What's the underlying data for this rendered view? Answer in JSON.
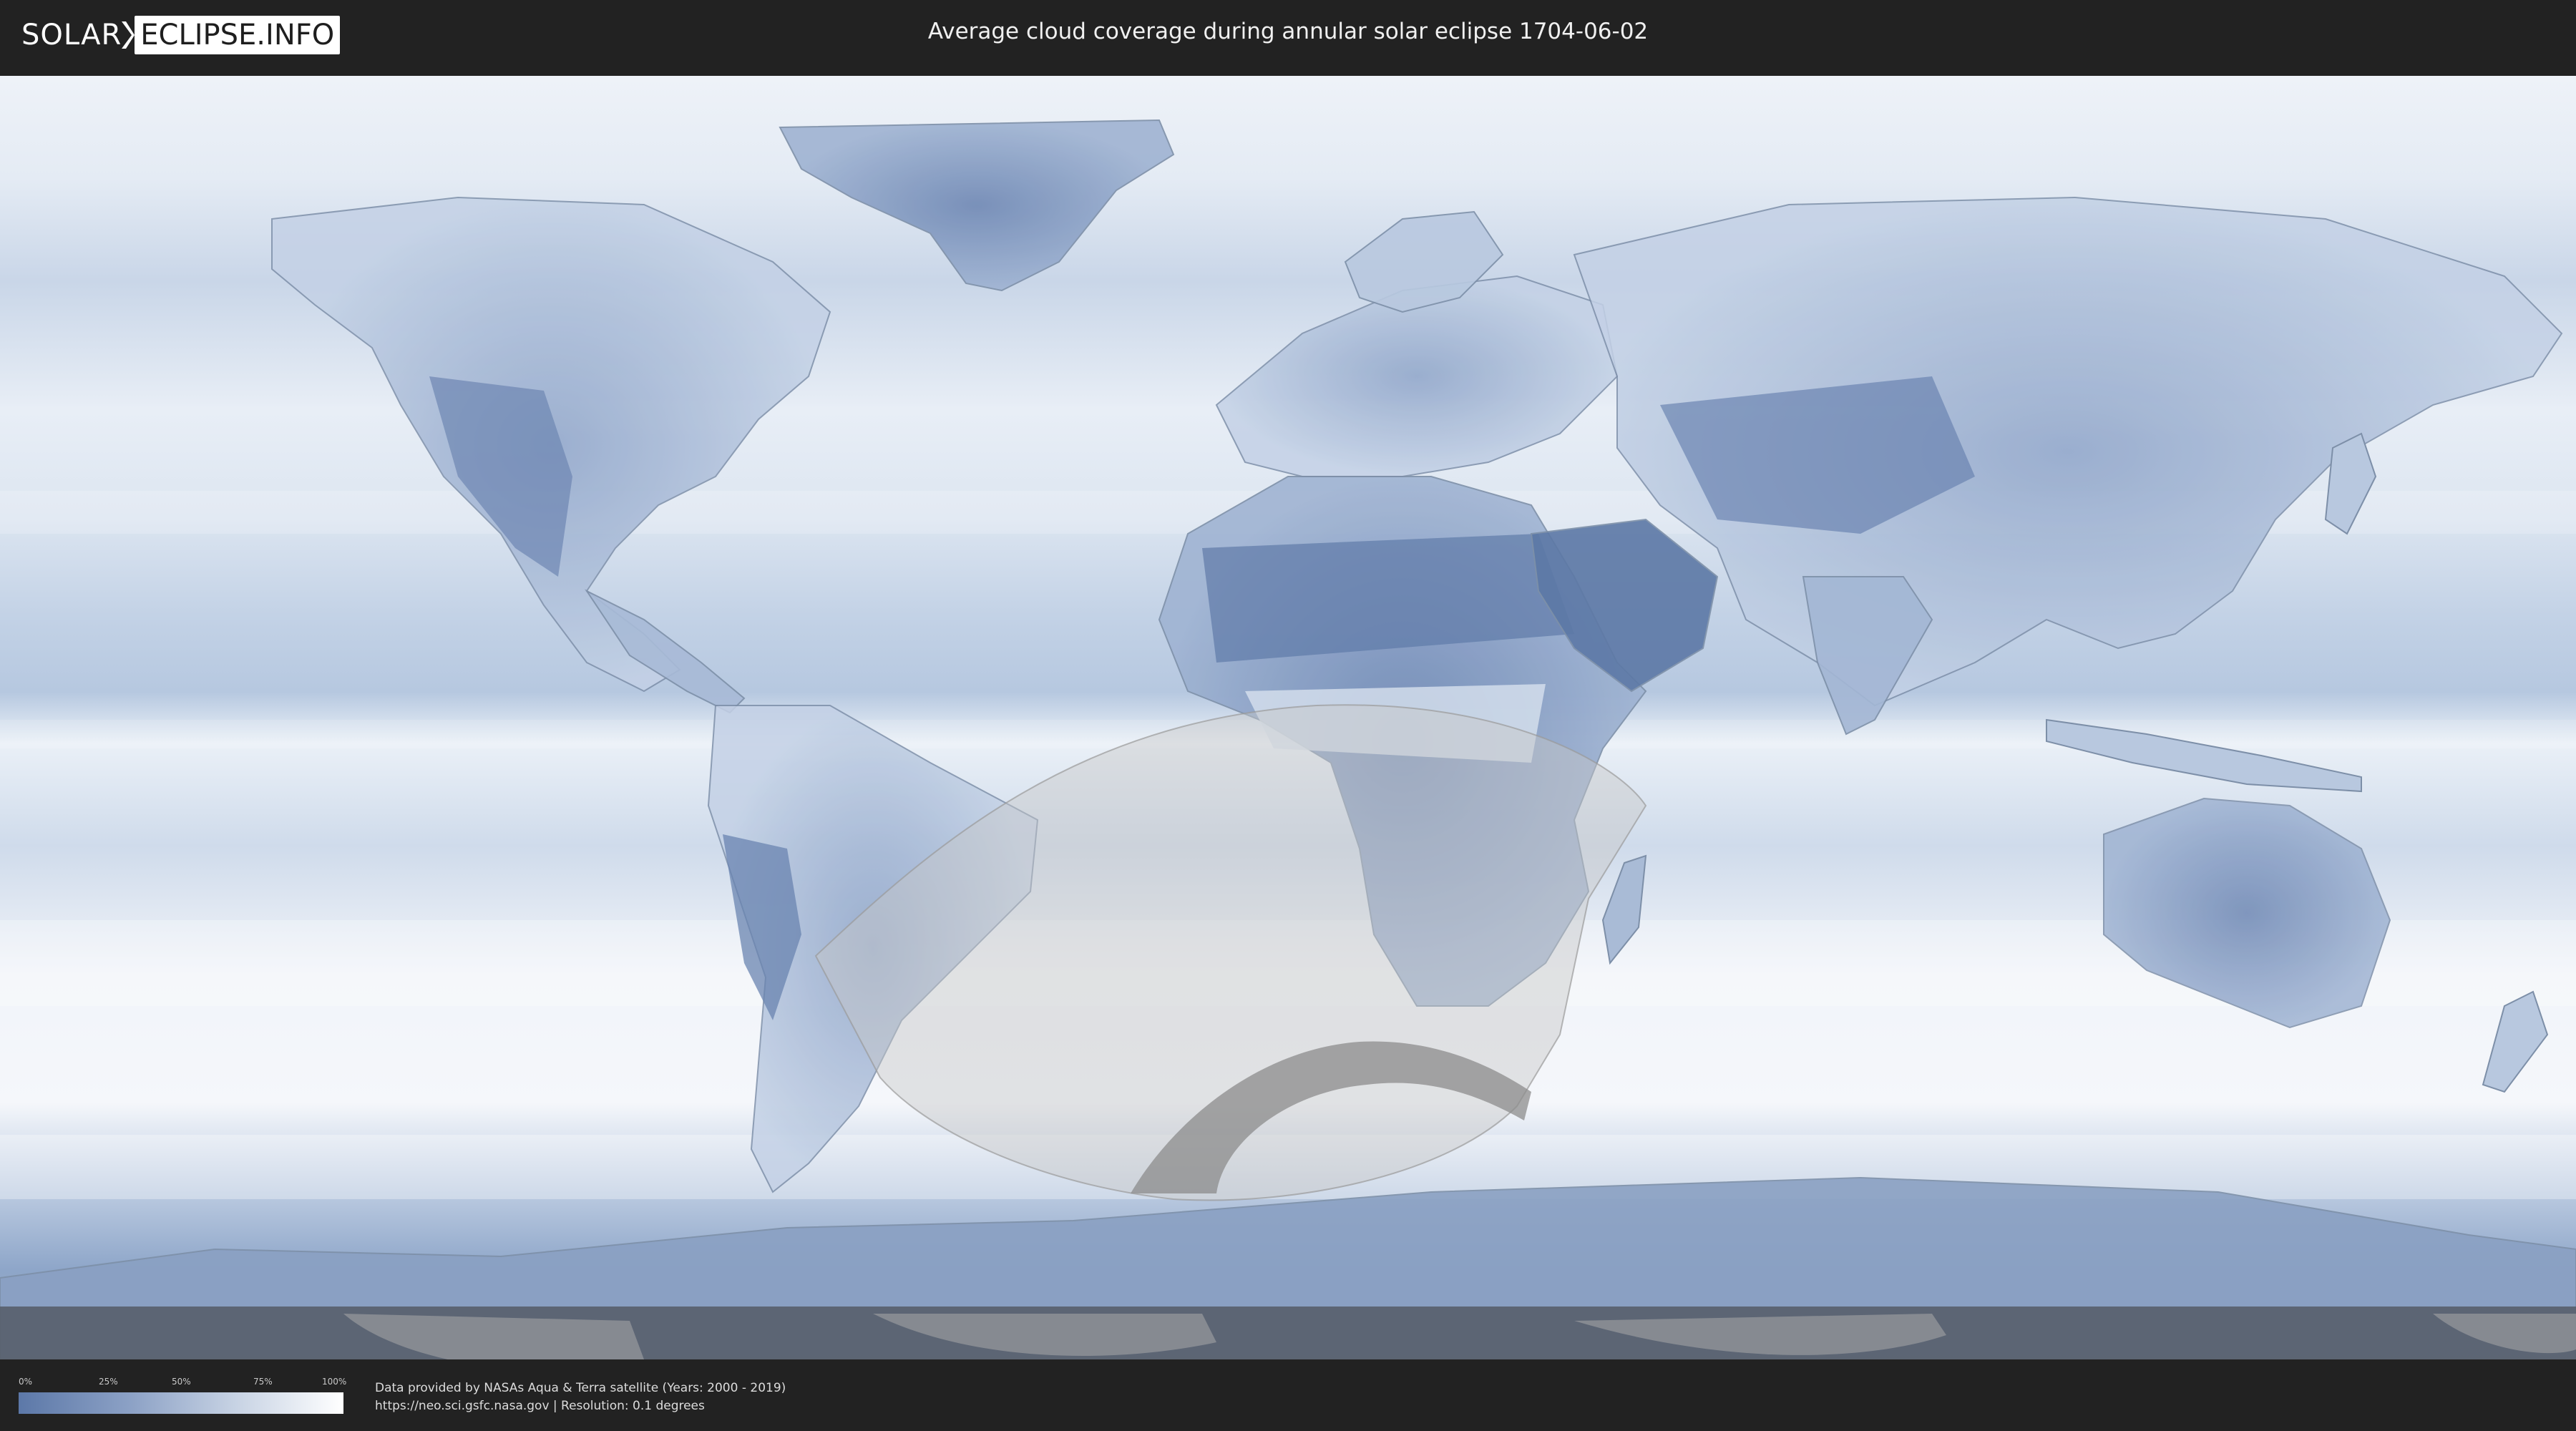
{
  "header": {
    "logo_left": "SOLAR",
    "logo_right": "ECLIPSE.INFO",
    "title": "Average cloud coverage during annular solar eclipse 1704-06-02"
  },
  "map": {
    "type": "equirectangular world map",
    "layer": "average cloud coverage",
    "eclipse_type": "annular",
    "eclipse_date": "1704-06-02",
    "colors": {
      "clear_sky": "#5c78a8",
      "full_cloud": "#ffffff",
      "visibility_overlay": "#c8c8c8",
      "annular_path": "#8c8c8c"
    }
  },
  "legend": {
    "ticks": [
      "0%",
      "25%",
      "50%",
      "75%",
      "100%"
    ],
    "scale": "0% = clear (blue) to 100% = fully cloudy (white)"
  },
  "footer": {
    "credit_line": "Data provided by NASAs Aqua & Terra satellite (Years: 2000 - 2019)",
    "source_line": "https://neo.sci.gsfc.nasa.gov | Resolution: 0.1 degrees"
  }
}
